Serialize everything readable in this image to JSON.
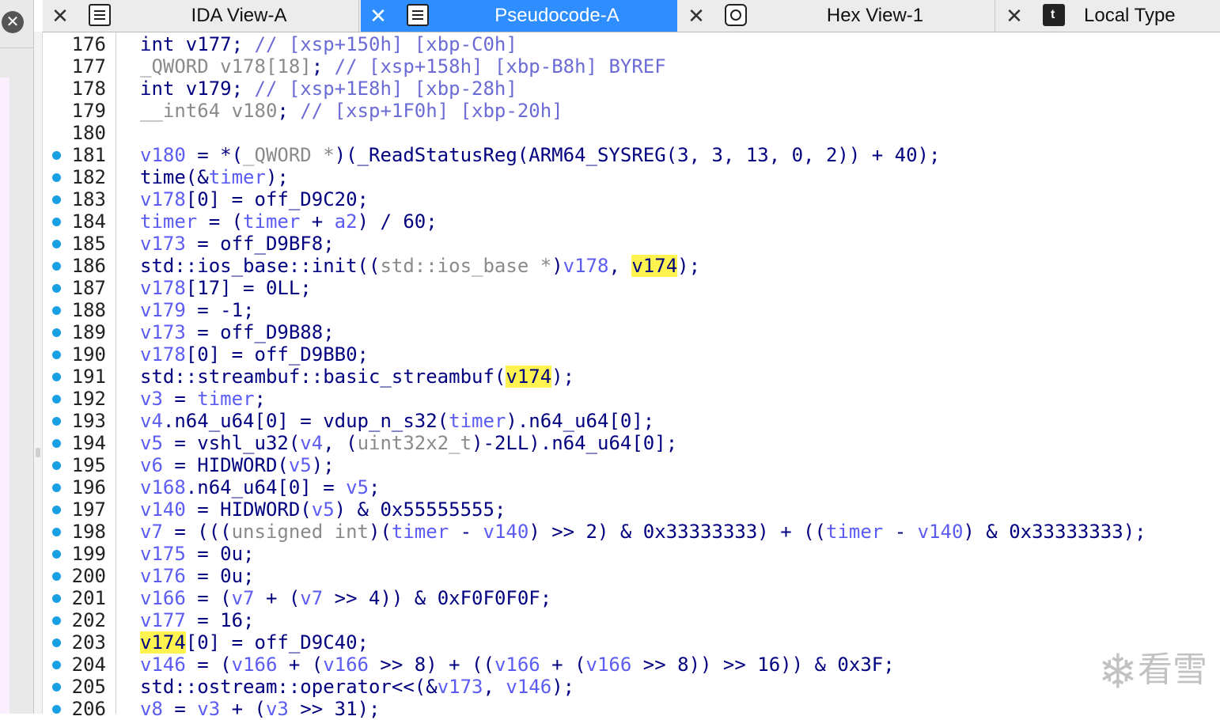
{
  "tabs": [
    {
      "label": "IDA View-A",
      "active": false,
      "icon": "listing-icon"
    },
    {
      "label": "Pseudocode-A",
      "active": true,
      "icon": "listing-icon"
    },
    {
      "label": "Hex View-1",
      "active": false,
      "icon": "hex-icon"
    },
    {
      "label": "Local Type",
      "active": false,
      "icon": "local-types-icon"
    }
  ],
  "watermark": {
    "text": "看雪",
    "icon": "snowflake-icon"
  },
  "colors": {
    "accent": "#2e8eff",
    "dot": "#18a0e3",
    "highlight": "#fff34f",
    "keyword": "#000080",
    "variable": "#5c5cf2",
    "comment": "#6b6bd6"
  },
  "lines": [
    {
      "n": "176",
      "dot": false,
      "t": [
        [
          "int v177; ",
          "k"
        ],
        [
          "// [xsp+150h] [xbp-C0h]",
          "c"
        ]
      ]
    },
    {
      "n": "177",
      "dot": false,
      "t": [
        [
          "_QWORD v178[18]",
          "g"
        ],
        [
          "; ",
          "k"
        ],
        [
          "// [xsp+158h] [xbp-B8h] BYREF",
          "c"
        ]
      ]
    },
    {
      "n": "178",
      "dot": false,
      "t": [
        [
          "int v179; ",
          "k"
        ],
        [
          "// [xsp+1E8h] [xbp-28h]",
          "c"
        ]
      ]
    },
    {
      "n": "179",
      "dot": false,
      "t": [
        [
          "__int64 v180",
          "g"
        ],
        [
          "; ",
          "k"
        ],
        [
          "// [xsp+1F0h] [xbp-20h]",
          "c"
        ]
      ]
    },
    {
      "n": "180",
      "dot": false,
      "t": []
    },
    {
      "n": "181",
      "dot": true,
      "t": [
        [
          "v180",
          "v"
        ],
        [
          " = *(",
          "k"
        ],
        [
          "_QWORD *",
          "g"
        ],
        [
          ")(_ReadStatusReg(ARM64_SYSREG(3, 3, 13, 0, 2)) + 40);",
          "k"
        ]
      ]
    },
    {
      "n": "182",
      "dot": true,
      "t": [
        [
          "time(&",
          "k"
        ],
        [
          "timer",
          "v"
        ],
        [
          ");",
          "k"
        ]
      ]
    },
    {
      "n": "183",
      "dot": true,
      "t": [
        [
          "v178",
          "v"
        ],
        [
          "[0] = off_D9C20;",
          "k"
        ]
      ]
    },
    {
      "n": "184",
      "dot": true,
      "t": [
        [
          "timer",
          "v"
        ],
        [
          " = (",
          "k"
        ],
        [
          "timer",
          "v"
        ],
        [
          " + ",
          "k"
        ],
        [
          "a2",
          "v"
        ],
        [
          ") / 60;",
          "k"
        ]
      ]
    },
    {
      "n": "185",
      "dot": true,
      "t": [
        [
          "v173",
          "v"
        ],
        [
          " = off_D9BF8;",
          "k"
        ]
      ]
    },
    {
      "n": "186",
      "dot": true,
      "t": [
        [
          "std::ios_base::init((",
          "k"
        ],
        [
          "std::ios_base *",
          "g"
        ],
        [
          ")",
          "k"
        ],
        [
          "v178",
          "v"
        ],
        [
          ", ",
          "k"
        ],
        [
          "v174",
          "hl"
        ],
        [
          ");",
          "k"
        ]
      ]
    },
    {
      "n": "187",
      "dot": true,
      "t": [
        [
          "v178",
          "v"
        ],
        [
          "[17] = 0LL;",
          "k"
        ]
      ]
    },
    {
      "n": "188",
      "dot": true,
      "t": [
        [
          "v179",
          "v"
        ],
        [
          " = -1;",
          "k"
        ]
      ]
    },
    {
      "n": "189",
      "dot": true,
      "t": [
        [
          "v173",
          "v"
        ],
        [
          " = off_D9B88;",
          "k"
        ]
      ]
    },
    {
      "n": "190",
      "dot": true,
      "t": [
        [
          "v178",
          "v"
        ],
        [
          "[0] = off_D9BB0;",
          "k"
        ]
      ]
    },
    {
      "n": "191",
      "dot": true,
      "t": [
        [
          "std::streambuf::basic_streambuf(",
          "k"
        ],
        [
          "v174",
          "hl"
        ],
        [
          ");",
          "k"
        ]
      ]
    },
    {
      "n": "192",
      "dot": true,
      "t": [
        [
          "v3",
          "v"
        ],
        [
          " = ",
          "k"
        ],
        [
          "timer",
          "v"
        ],
        [
          ";",
          "k"
        ]
      ]
    },
    {
      "n": "193",
      "dot": true,
      "t": [
        [
          "v4",
          "v"
        ],
        [
          ".n64_u64[0] = vdup_n_s32(",
          "k"
        ],
        [
          "timer",
          "v"
        ],
        [
          ").n64_u64[0];",
          "k"
        ]
      ]
    },
    {
      "n": "194",
      "dot": true,
      "t": [
        [
          "v5",
          "v"
        ],
        [
          " = vshl_u32(",
          "k"
        ],
        [
          "v4",
          "v"
        ],
        [
          ", (",
          "k"
        ],
        [
          "uint32x2_t",
          "g"
        ],
        [
          ")-2LL).n64_u64[0];",
          "k"
        ]
      ]
    },
    {
      "n": "195",
      "dot": true,
      "t": [
        [
          "v6",
          "v"
        ],
        [
          " = HIDWORD(",
          "k"
        ],
        [
          "v5",
          "v"
        ],
        [
          ");",
          "k"
        ]
      ]
    },
    {
      "n": "196",
      "dot": true,
      "t": [
        [
          "v168",
          "v"
        ],
        [
          ".n64_u64[0] = ",
          "k"
        ],
        [
          "v5",
          "v"
        ],
        [
          ";",
          "k"
        ]
      ]
    },
    {
      "n": "197",
      "dot": true,
      "t": [
        [
          "v140",
          "v"
        ],
        [
          " = HIDWORD(",
          "k"
        ],
        [
          "v5",
          "v"
        ],
        [
          ") & 0x55555555;",
          "k"
        ]
      ]
    },
    {
      "n": "198",
      "dot": true,
      "t": [
        [
          "v7",
          "v"
        ],
        [
          " = (((",
          "k"
        ],
        [
          "unsigned int",
          "g"
        ],
        [
          ")(",
          "k"
        ],
        [
          "timer",
          "v"
        ],
        [
          " - ",
          "k"
        ],
        [
          "v140",
          "v"
        ],
        [
          ") >> 2) & 0x33333333) + ((",
          "k"
        ],
        [
          "timer",
          "v"
        ],
        [
          " - ",
          "k"
        ],
        [
          "v140",
          "v"
        ],
        [
          ") & 0x33333333);",
          "k"
        ]
      ]
    },
    {
      "n": "199",
      "dot": true,
      "t": [
        [
          "v175",
          "v"
        ],
        [
          " = 0u;",
          "k"
        ]
      ]
    },
    {
      "n": "200",
      "dot": true,
      "t": [
        [
          "v176",
          "v"
        ],
        [
          " = 0u;",
          "k"
        ]
      ]
    },
    {
      "n": "201",
      "dot": true,
      "t": [
        [
          "v166",
          "v"
        ],
        [
          " = (",
          "k"
        ],
        [
          "v7",
          "v"
        ],
        [
          " + (",
          "k"
        ],
        [
          "v7",
          "v"
        ],
        [
          " >> 4)) & 0xF0F0F0F;",
          "k"
        ]
      ]
    },
    {
      "n": "202",
      "dot": true,
      "t": [
        [
          "v177",
          "v"
        ],
        [
          " = 16;",
          "k"
        ]
      ]
    },
    {
      "n": "203",
      "dot": true,
      "t": [
        [
          "v174",
          "hl"
        ],
        [
          "[0] = off_D9C40;",
          "k"
        ]
      ]
    },
    {
      "n": "204",
      "dot": true,
      "t": [
        [
          "v146",
          "v"
        ],
        [
          " = (",
          "k"
        ],
        [
          "v166",
          "v"
        ],
        [
          " + (",
          "k"
        ],
        [
          "v166",
          "v"
        ],
        [
          " >> 8) + ((",
          "k"
        ],
        [
          "v166",
          "v"
        ],
        [
          " + (",
          "k"
        ],
        [
          "v166",
          "v"
        ],
        [
          " >> 8)) >> 16)) & 0x3F;",
          "k"
        ]
      ]
    },
    {
      "n": "205",
      "dot": true,
      "t": [
        [
          "std::ostream::operator<<(&",
          "k"
        ],
        [
          "v173",
          "v"
        ],
        [
          ", ",
          "k"
        ],
        [
          "v146",
          "v"
        ],
        [
          ");",
          "k"
        ]
      ]
    },
    {
      "n": "206",
      "dot": true,
      "t": [
        [
          "v8",
          "v"
        ],
        [
          " = ",
          "k"
        ],
        [
          "v3",
          "v"
        ],
        [
          " + (",
          "k"
        ],
        [
          "v3",
          "v"
        ],
        [
          " >> 31);",
          "k"
        ]
      ]
    }
  ]
}
